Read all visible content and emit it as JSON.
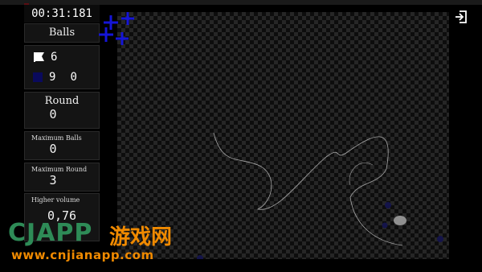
{
  "timer": "00:31:181",
  "balls_panel": {
    "title": "Balls"
  },
  "counts": {
    "white_count": "6",
    "dark_count": "9",
    "dark_extra": "0"
  },
  "round_panel": {
    "title": "Round",
    "value": "0"
  },
  "max_balls_panel": {
    "title": "Maximum Balls",
    "value": "0"
  },
  "max_round_panel": {
    "title": "Maximum Round",
    "value": "3"
  },
  "volume_panel": {
    "title": "Higher volume",
    "value": "0,76"
  },
  "icons": {
    "exit": "exit-icon",
    "white_flag": "flag-icon",
    "plus_markers": "plus-icon"
  },
  "colors": {
    "background": "#000000",
    "board_dark": "#0d0d0d",
    "board_light": "#262626",
    "plus_blue": "#1515d8",
    "dark_team": "#0a0a5c"
  },
  "watermark": {
    "brand": "CJAPP",
    "chinese": "游戏网",
    "url": "www.cnjianapp.com"
  }
}
